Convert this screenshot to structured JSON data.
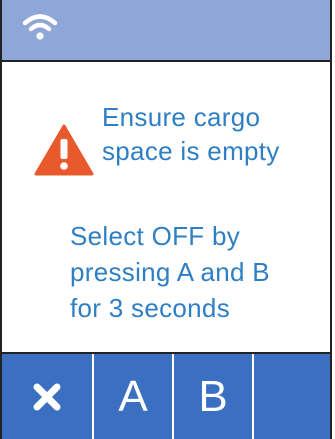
{
  "status_bar": {
    "icon": "wifi-icon"
  },
  "warning": {
    "icon": "warning-icon",
    "line1": "Ensure cargo",
    "line2": "space is empty"
  },
  "instruction": {
    "line1": "Select OFF by",
    "line2": "pressing A and B",
    "line3": "for 3 seconds"
  },
  "buttons": {
    "close_icon": "close-icon",
    "a_label": "A",
    "b_label": "B"
  },
  "colors": {
    "status_bar": "#8fa6d8",
    "text": "#2f7fc4",
    "warning": "#e8592c",
    "button": "#3a6fc1"
  }
}
